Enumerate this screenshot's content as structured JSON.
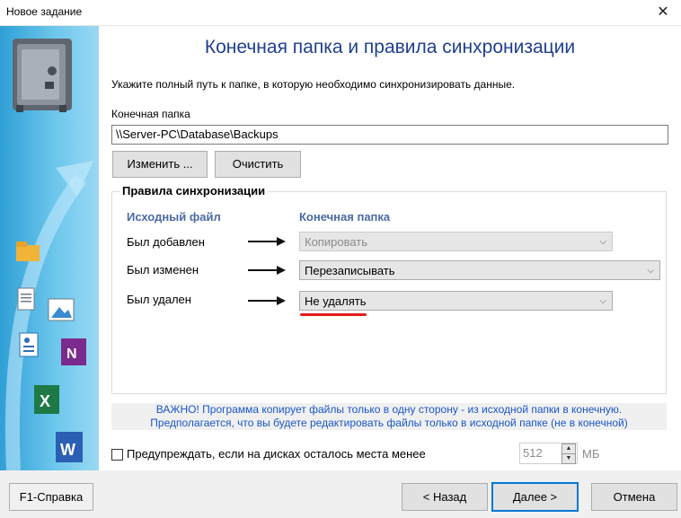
{
  "window": {
    "title": "Новое задание",
    "close_glyph": "✕"
  },
  "page": {
    "heading": "Конечная папка и правила синхронизации",
    "instruction": "Укажите полный путь к папке, в которую необходимо синхронизировать данные."
  },
  "target_folder": {
    "label": "Конечная папка",
    "value": "\\\\Server-PC\\Database\\Backups",
    "change_button": "Изменить ...",
    "clear_button": "Очистить"
  },
  "rules": {
    "group_title": "Правила синхронизации",
    "source_header": "Исходный файл",
    "target_header": "Конечная папка",
    "rows": [
      {
        "label": "Был добавлен",
        "value": "Копировать",
        "disabled": true
      },
      {
        "label": "Был изменен",
        "value": "Перезаписывать",
        "disabled": false
      },
      {
        "label": "Был удален",
        "value": "Не удалять",
        "disabled": false
      }
    ]
  },
  "notice": {
    "line1": "ВАЖНО! Программа копирует файлы только в одну сторону - из исходной папки в конечную.",
    "line2": "Предполагается, что вы будете редактировать файлы только в исходной папке (не в конечной)"
  },
  "disk_warning": {
    "label": "Предупреждать, если на дисках осталось места менее",
    "checked": false,
    "value": "512",
    "unit": "МБ"
  },
  "footer": {
    "help": "F1-Справка",
    "back": "< Назад",
    "next": "Далее >",
    "cancel": "Отмена"
  },
  "sidebar": {
    "icons": [
      "safe-icon",
      "folder-icon",
      "document-icon",
      "image-icon",
      "contacts-icon",
      "onenote-icon",
      "excel-icon",
      "word-icon"
    ]
  },
  "colors": {
    "heading": "#1f3f8f",
    "column_header": "#4a6aa5",
    "notice_text": "#1a56c8",
    "accent_underline": "#e51b1b",
    "sidebar_blue": "#2f9fd6",
    "primary_border": "#0078d7"
  }
}
